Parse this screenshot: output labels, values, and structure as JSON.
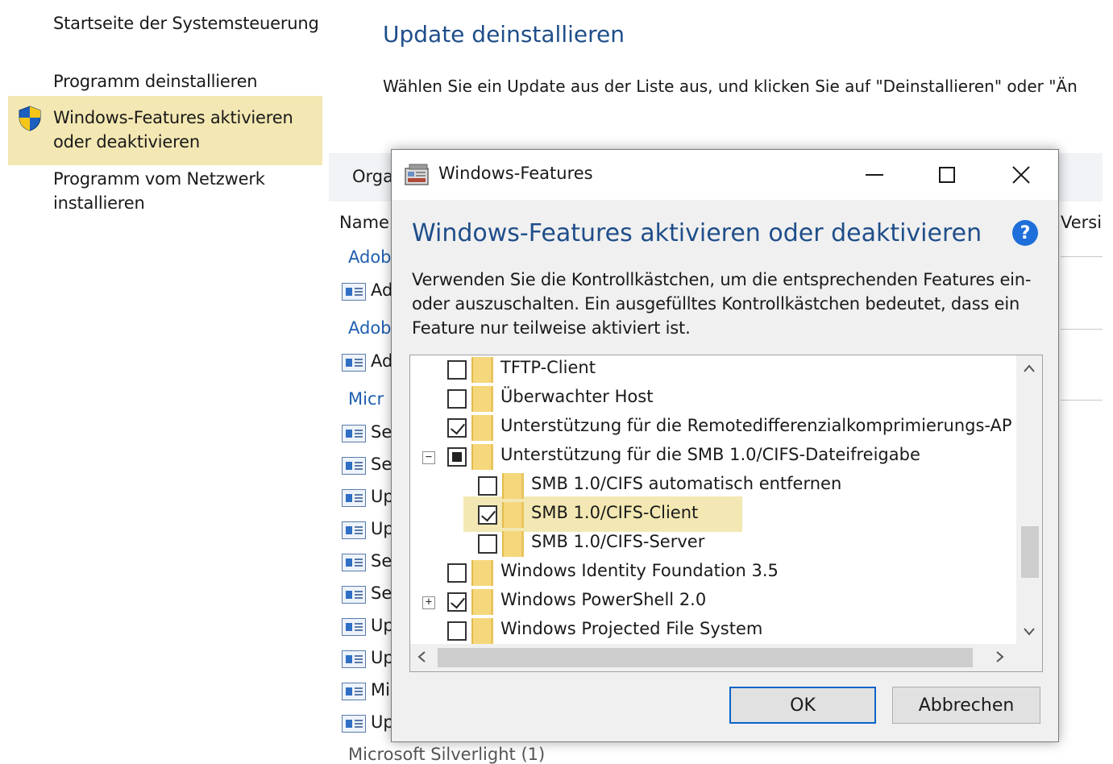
{
  "nav": {
    "home": "Startseite der Systemsteuerung",
    "uninstall": "Programm deinstallieren",
    "features_line1": "Windows-Features aktivieren",
    "features_line2": "oder deaktivieren",
    "network_line1": "Programm vom Netzwerk",
    "network_line2": "installieren"
  },
  "page": {
    "title": "Update deinstallieren",
    "description": "Wählen Sie ein Update aus der Liste aus, und klicken Sie auf \"Deinstallieren\" oder \"Än",
    "toolbar_label": "Orga",
    "col_name": "Name",
    "col_version": "Versi",
    "groups": [
      "Adob",
      "Adob",
      "Micr"
    ],
    "rows": [
      "Ad",
      "Ad",
      "Se",
      "Se",
      "Up",
      "Up",
      "Se",
      "Se",
      "Up",
      "Up",
      "Mi",
      "Up"
    ],
    "bottom_hint": "Microsoft Silverlight (1)"
  },
  "dialog": {
    "title": "Windows-Features",
    "heading": "Windows-Features aktivieren oder deaktivieren",
    "help_label": "?",
    "description": "Verwenden Sie die Kontrollkästchen, um die entsprechenden Features ein- oder auszuschalten. Ein ausgefülltes Kontrollkästchen bedeutet, dass ein Feature nur teilweise aktiviert ist.",
    "features": [
      {
        "label": "TFTP-Client",
        "state": "unchecked",
        "level": 0,
        "expander": ""
      },
      {
        "label": "Überwachter Host",
        "state": "unchecked",
        "level": 0,
        "expander": ""
      },
      {
        "label": "Unterstützung für die Remotedifferenzialkomprimierungs-AP",
        "state": "checked",
        "level": 0,
        "expander": ""
      },
      {
        "label": "Unterstützung für die SMB 1.0/CIFS-Dateifreigabe",
        "state": "partial",
        "level": 0,
        "expander": "−"
      },
      {
        "label": "SMB 1.0/CIFS automatisch entfernen",
        "state": "unchecked",
        "level": 1,
        "expander": ""
      },
      {
        "label": "SMB 1.0/CIFS-Client",
        "state": "checked",
        "level": 1,
        "expander": ""
      },
      {
        "label": "SMB 1.0/CIFS-Server",
        "state": "unchecked",
        "level": 1,
        "expander": ""
      },
      {
        "label": "Windows Identity Foundation 3.5",
        "state": "unchecked",
        "level": 0,
        "expander": ""
      },
      {
        "label": "Windows PowerShell 2.0",
        "state": "checked",
        "level": 0,
        "expander": "+"
      },
      {
        "label": "Windows Projected File System",
        "state": "unchecked",
        "level": 0,
        "expander": ""
      }
    ],
    "ok_label": "OK",
    "cancel_label": "Abbrechen"
  },
  "icons": {
    "shield": "uac-shield-icon",
    "app": "windows-features-icon",
    "minimize": "minimize-icon",
    "maximize": "maximize-icon",
    "close": "close-icon"
  },
  "colors": {
    "accent": "#1f4e8a",
    "highlight": "#f3e8b3",
    "link": "#1f5fb0"
  }
}
